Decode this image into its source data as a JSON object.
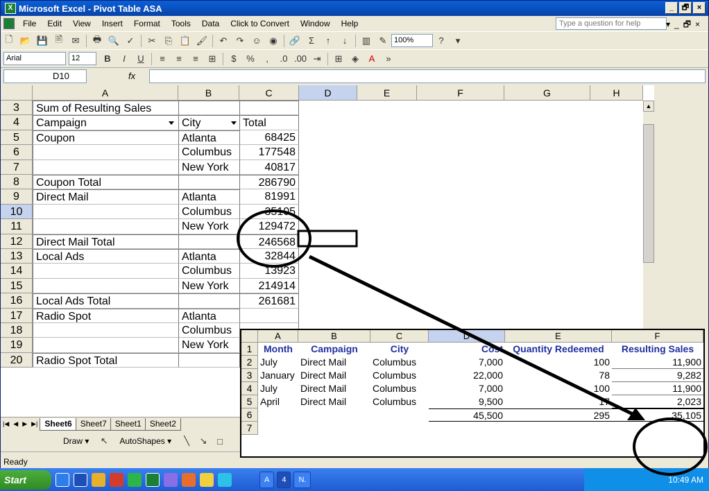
{
  "window": {
    "title": "Microsoft Excel - Pivot Table ASA",
    "buttons": [
      "_",
      "🗗",
      "×"
    ]
  },
  "menu": {
    "items": [
      "File",
      "Edit",
      "View",
      "Insert",
      "Format",
      "Tools",
      "Data",
      "Click to Convert",
      "Window",
      "Help"
    ],
    "help_placeholder": "Type a question for help"
  },
  "toolbar": {
    "zoom": "100%",
    "font": "Arial",
    "size": "12"
  },
  "formula": {
    "name_box": "D10",
    "fx": "fx"
  },
  "sheet": {
    "columns": [
      "A",
      "B",
      "C",
      "D",
      "E",
      "F",
      "G",
      "H"
    ],
    "selected_column": "D",
    "selected_row": "10",
    "rows": [
      {
        "n": "3",
        "a": "Sum of Resulting Sales",
        "b": "",
        "c": ""
      },
      {
        "n": "4",
        "a": "Campaign",
        "b": "City",
        "c": "Total"
      },
      {
        "n": "5",
        "a": "Coupon",
        "b": "Atlanta",
        "c": "68425"
      },
      {
        "n": "6",
        "a": "",
        "b": "Columbus",
        "c": "177548"
      },
      {
        "n": "7",
        "a": "",
        "b": "New York",
        "c": "40817"
      },
      {
        "n": "8",
        "a": "Coupon Total",
        "b": "",
        "c": "286790"
      },
      {
        "n": "9",
        "a": "Direct Mail",
        "b": "Atlanta",
        "c": "81991"
      },
      {
        "n": "10",
        "a": "",
        "b": "Columbus",
        "c": "35105"
      },
      {
        "n": "11",
        "a": "",
        "b": "New York",
        "c": "129472"
      },
      {
        "n": "12",
        "a": "Direct Mail Total",
        "b": "",
        "c": "246568"
      },
      {
        "n": "13",
        "a": "Local Ads",
        "b": "Atlanta",
        "c": "32844"
      },
      {
        "n": "14",
        "a": "",
        "b": "Columbus",
        "c": "13923"
      },
      {
        "n": "15",
        "a": "",
        "b": "New York",
        "c": "214914"
      },
      {
        "n": "16",
        "a": "Local Ads Total",
        "b": "",
        "c": "261681"
      },
      {
        "n": "17",
        "a": "Radio Spot",
        "b": "Atlanta",
        "c": ""
      },
      {
        "n": "18",
        "a": "",
        "b": "Columbus",
        "c": ""
      },
      {
        "n": "19",
        "a": "",
        "b": "New York",
        "c": ""
      },
      {
        "n": "20",
        "a": "Radio Spot Total",
        "b": "",
        "c": ""
      }
    ]
  },
  "tabs": [
    "Sheet6",
    "Sheet7",
    "Sheet1",
    "Sheet2"
  ],
  "drawbar": {
    "draw": "Draw ▾",
    "autoshapes": "AutoShapes ▾"
  },
  "status": "Ready",
  "taskbar": {
    "start": "Start",
    "buttons": [
      "A",
      "4",
      "N."
    ],
    "clock": "10:49 AM"
  },
  "detail": {
    "columns": [
      "A",
      "B",
      "C",
      "D",
      "E",
      "F"
    ],
    "selected_column": "D",
    "headers": [
      "Month",
      "Campaign",
      "City",
      "Cost",
      "Quantity Redeemed",
      "Resulting Sales"
    ],
    "rows": [
      {
        "n": "2",
        "month": "July",
        "campaign": "Direct Mail",
        "city": "Columbus",
        "cost": "7,000",
        "qty": "100",
        "sales": "11,900"
      },
      {
        "n": "3",
        "month": "January",
        "campaign": "Direct Mail",
        "city": "Columbus",
        "cost": "22,000",
        "qty": "78",
        "sales": "9,282"
      },
      {
        "n": "4",
        "month": "July",
        "campaign": "Direct Mail",
        "city": "Columbus",
        "cost": "7,000",
        "qty": "100",
        "sales": "11,900"
      },
      {
        "n": "5",
        "month": "April",
        "campaign": "Direct Mail",
        "city": "Columbus",
        "cost": "9,500",
        "qty": "17",
        "sales": "2,023"
      }
    ],
    "totals": {
      "n": "6",
      "cost": "45,500",
      "qty": "295",
      "sales": "35,105"
    },
    "empty_row": "7",
    "row1": "1"
  }
}
